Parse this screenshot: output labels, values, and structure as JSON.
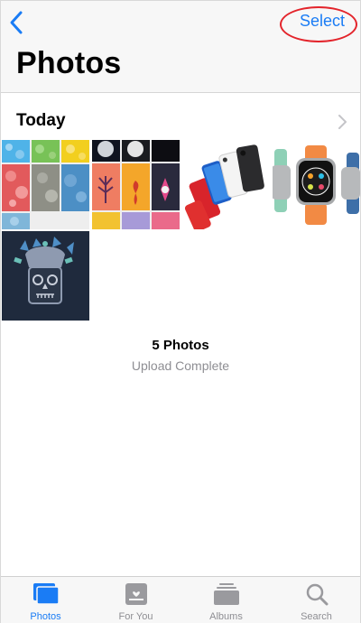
{
  "nav": {
    "select_label": "Select",
    "title": "Photos",
    "back_icon": "chevron-left-icon"
  },
  "section": {
    "title": "Today",
    "chevron_icon": "chevron-right-icon"
  },
  "summary": {
    "count": "5 Photos",
    "status": "Upload Complete"
  },
  "tabs": [
    {
      "label": "Photos",
      "icon": "photos-tab-icon",
      "active": true
    },
    {
      "label": "For You",
      "icon": "for-you-tab-icon",
      "active": false
    },
    {
      "label": "Albums",
      "icon": "albums-tab-icon",
      "active": false
    },
    {
      "label": "Search",
      "icon": "search-icon",
      "active": false
    }
  ],
  "colors": {
    "accent": "#1a7cf5",
    "annotation": "#e3242b",
    "inactive": "#8e8e93"
  }
}
